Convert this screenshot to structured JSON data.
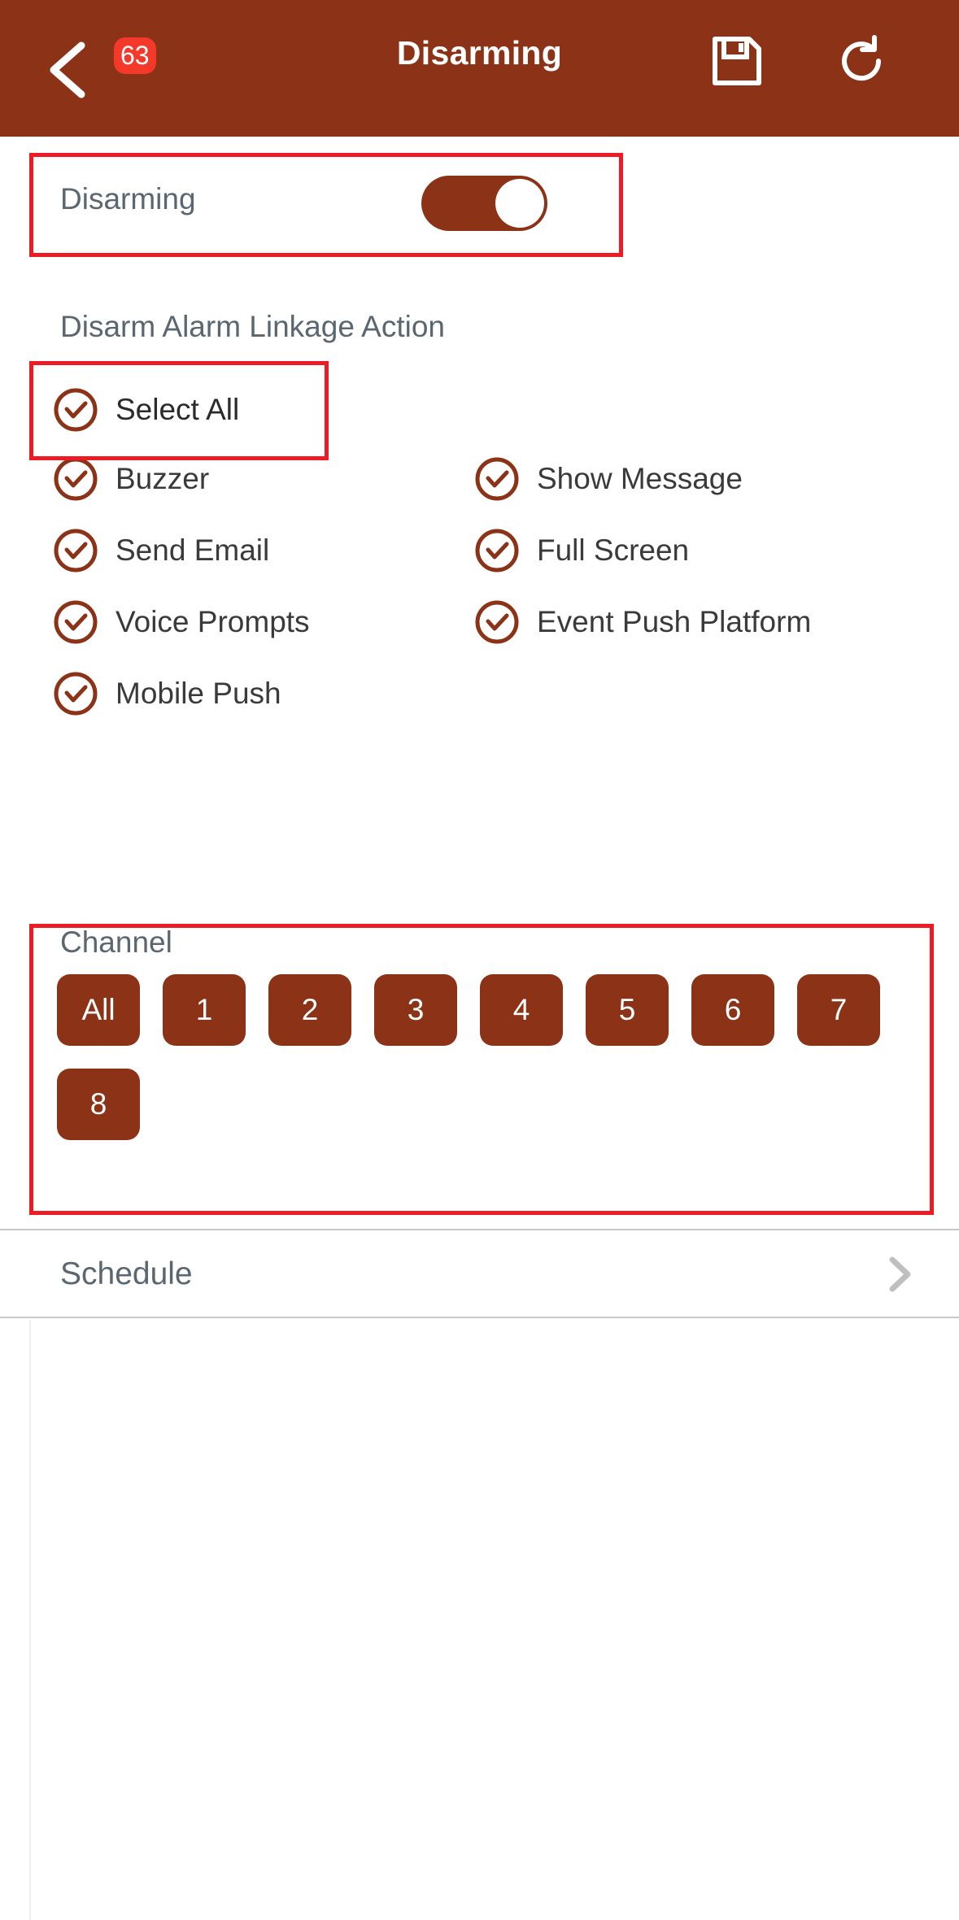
{
  "appbar": {
    "title": "Disarming",
    "back_icon": "chevron-left-icon",
    "badge_count": "63",
    "save_icon": "save-floppy-icon",
    "refresh_icon": "refresh-icon"
  },
  "disarming": {
    "label": "Disarming",
    "toggle_state": "on"
  },
  "linkage": {
    "section_title": "Disarm Alarm Linkage Action",
    "select_all_label": "Select All",
    "select_all_checked": true,
    "actions": [
      {
        "label": "Buzzer",
        "checked": true,
        "column": "left"
      },
      {
        "label": "Show Message",
        "checked": true,
        "column": "right"
      },
      {
        "label": "Send Email",
        "checked": true,
        "column": "left"
      },
      {
        "label": "Full Screen",
        "checked": true,
        "column": "right"
      },
      {
        "label": "Voice Prompts",
        "checked": true,
        "column": "left"
      },
      {
        "label": "Event Push Platform",
        "checked": true,
        "column": "right"
      },
      {
        "label": "Mobile Push",
        "checked": true,
        "column": "left"
      }
    ]
  },
  "channel": {
    "title": "Channel",
    "chips": [
      "All",
      "1",
      "2",
      "3",
      "4",
      "5",
      "6",
      "7",
      "8"
    ]
  },
  "schedule": {
    "label": "Schedule",
    "chevron_icon": "chevron-right-icon"
  },
  "colors": {
    "brand_brown": "#8B3217",
    "badge_red": "#F4392B",
    "annotation_red": "#ED1C24",
    "label_gray": "#5B6770",
    "text_dark": "#3A3A3A"
  }
}
